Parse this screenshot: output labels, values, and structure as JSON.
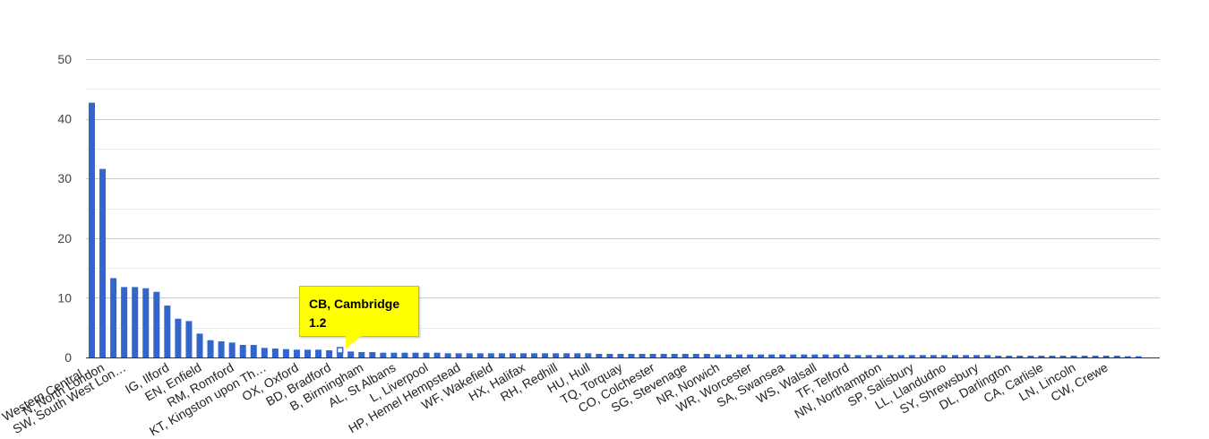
{
  "colors": {
    "bar": "#3366cc",
    "grid": "#cccccc",
    "minor_grid": "#ebebeb",
    "tooltip_bg": "#ffff00"
  },
  "tooltip": {
    "title": "CB, Cambridge",
    "value": "1.2"
  },
  "chart_data": {
    "type": "bar",
    "title": "",
    "xlabel": "",
    "ylabel": "",
    "ylim": [
      0,
      50
    ],
    "yticks": [
      0,
      10,
      20,
      30,
      40,
      50
    ],
    "grid": true,
    "legend": "none",
    "labels": [
      {
        "idx": 0,
        "text": "Western Central…"
      },
      {
        "idx": 1,
        "text": "N, North London"
      },
      {
        "idx": 3,
        "text": "SW, South West Lon…"
      },
      {
        "idx": 7,
        "text": "IG, Ilford"
      },
      {
        "idx": 10,
        "text": "EN, Enfield"
      },
      {
        "idx": 13,
        "text": "RM, Romford"
      },
      {
        "idx": 16,
        "text": "KT, Kingston upon Th…"
      },
      {
        "idx": 19,
        "text": "OX, Oxford"
      },
      {
        "idx": 22,
        "text": "BD, Bradford"
      },
      {
        "idx": 25,
        "text": "B, Birmingham"
      },
      {
        "idx": 28,
        "text": "AL, St Albans"
      },
      {
        "idx": 31,
        "text": "L, Liverpool"
      },
      {
        "idx": 34,
        "text": "HP, Hemel Hempstead"
      },
      {
        "idx": 37,
        "text": "WF, Wakefield"
      },
      {
        "idx": 40,
        "text": "HX, Halifax"
      },
      {
        "idx": 43,
        "text": "RH, Redhill"
      },
      {
        "idx": 46,
        "text": "HU, Hull"
      },
      {
        "idx": 49,
        "text": "TQ, Torquay"
      },
      {
        "idx": 52,
        "text": "CO, Colchester"
      },
      {
        "idx": 55,
        "text": "SG, Stevenage"
      },
      {
        "idx": 58,
        "text": "NR, Norwich"
      },
      {
        "idx": 61,
        "text": "WR, Worcester"
      },
      {
        "idx": 64,
        "text": "SA, Swansea"
      },
      {
        "idx": 67,
        "text": "WS, Walsall"
      },
      {
        "idx": 70,
        "text": "TF, Telford"
      },
      {
        "idx": 73,
        "text": "NN, Northampton"
      },
      {
        "idx": 76,
        "text": "SP, Salisbury"
      },
      {
        "idx": 79,
        "text": "LL, Llandudno"
      },
      {
        "idx": 82,
        "text": "SY, Shrewsbury"
      },
      {
        "idx": 85,
        "text": "DL, Darlington"
      },
      {
        "idx": 88,
        "text": "CA, Carlisle"
      },
      {
        "idx": 91,
        "text": "LN, Lincoln"
      },
      {
        "idx": 94,
        "text": "CW, Crewe"
      }
    ],
    "values": [
      42.7,
      31.6,
      13.3,
      11.8,
      11.8,
      11.6,
      11.0,
      8.7,
      6.5,
      6.1,
      4.0,
      2.9,
      2.7,
      2.5,
      2.1,
      2.1,
      1.6,
      1.5,
      1.4,
      1.3,
      1.3,
      1.3,
      1.2,
      1.2,
      1.0,
      0.9,
      0.9,
      0.8,
      0.8,
      0.8,
      0.8,
      0.8,
      0.8,
      0.7,
      0.7,
      0.7,
      0.7,
      0.7,
      0.7,
      0.7,
      0.7,
      0.7,
      0.7,
      0.7,
      0.7,
      0.7,
      0.7,
      0.6,
      0.6,
      0.6,
      0.6,
      0.6,
      0.6,
      0.6,
      0.6,
      0.6,
      0.6,
      0.6,
      0.5,
      0.5,
      0.5,
      0.5,
      0.5,
      0.5,
      0.5,
      0.5,
      0.5,
      0.5,
      0.5,
      0.5,
      0.5,
      0.4,
      0.4,
      0.4,
      0.4,
      0.4,
      0.4,
      0.4,
      0.4,
      0.4,
      0.4,
      0.4,
      0.4,
      0.4,
      0.3,
      0.3,
      0.3,
      0.3,
      0.3,
      0.3,
      0.3,
      0.3,
      0.3,
      0.3,
      0.3,
      0.3,
      0.2,
      0.2
    ]
  }
}
